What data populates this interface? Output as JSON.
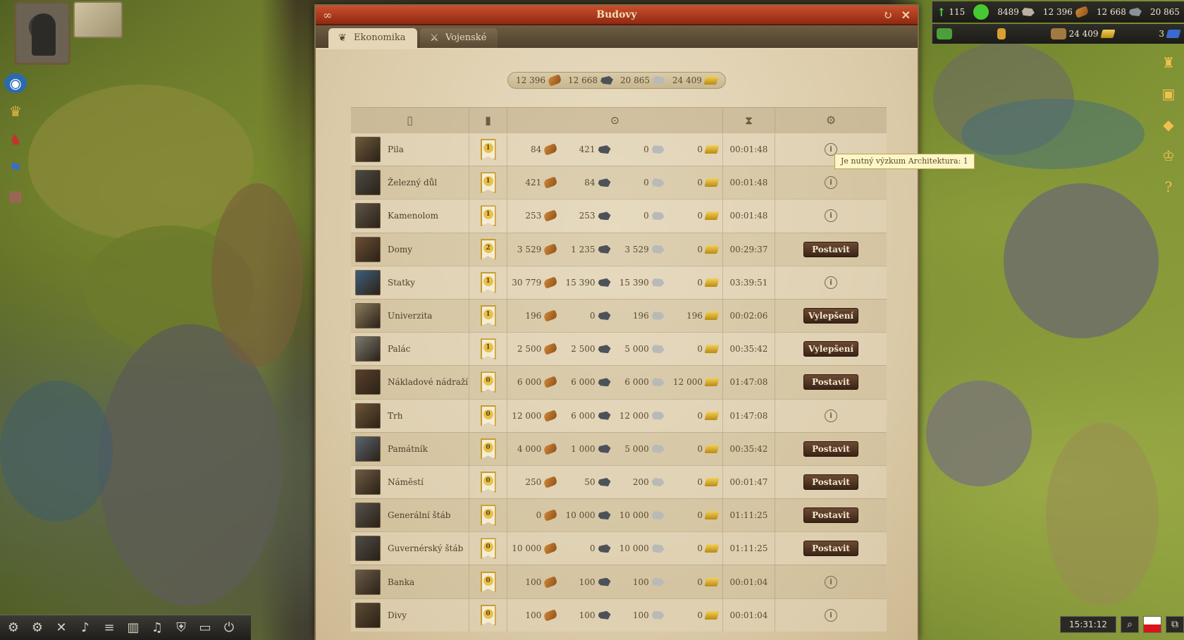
{
  "dialog": {
    "title": "Budovy",
    "tabs": [
      {
        "label": "Ekonomika",
        "active": true
      },
      {
        "label": "Vojenské",
        "active": false
      }
    ]
  },
  "summary": {
    "wood": "12 396",
    "iron": "12 668",
    "stone": "20 865",
    "gold": "24 409"
  },
  "buildings": [
    {
      "name": "Pila",
      "level": "1",
      "wood": "84",
      "iron": "421",
      "stone": "0",
      "gold": "0",
      "time": "00:01:48",
      "action": "info",
      "thumb": "#6f5a3c"
    },
    {
      "name": "Železný důl",
      "level": "1",
      "wood": "421",
      "iron": "84",
      "stone": "0",
      "gold": "0",
      "time": "00:01:48",
      "action": "info",
      "thumb": "#4c4a44"
    },
    {
      "name": "Kamenolom",
      "level": "1",
      "wood": "253",
      "iron": "253",
      "stone": "0",
      "gold": "0",
      "time": "00:01:48",
      "action": "info",
      "thumb": "#5e5446"
    },
    {
      "name": "Domy",
      "level": "2",
      "wood": "3 529",
      "iron": "1 235",
      "stone": "3 529",
      "gold": "0",
      "time": "00:29:37",
      "action": "button",
      "action_label": "Postavit",
      "thumb": "#6a4e34"
    },
    {
      "name": "Statky",
      "level": "1",
      "wood": "30 779",
      "iron": "15 390",
      "stone": "15 390",
      "gold": "0",
      "time": "03:39:51",
      "action": "info",
      "thumb": "#3f5e7a"
    },
    {
      "name": "Univerzita",
      "level": "1",
      "wood": "196",
      "iron": "0",
      "stone": "196",
      "gold": "196",
      "time": "00:02:06",
      "action": "button",
      "action_label": "Vylepšení",
      "thumb": "#8a7a5a"
    },
    {
      "name": "Palác",
      "level": "1",
      "wood": "2 500",
      "iron": "2 500",
      "stone": "5 000",
      "gold": "0",
      "time": "00:35:42",
      "action": "button",
      "action_label": "Vylepšení",
      "thumb": "#7a7a70"
    },
    {
      "name": "Nákladové nádraží",
      "level": "0",
      "wood": "6 000",
      "iron": "6 000",
      "stone": "6 000",
      "gold": "12 000",
      "time": "01:47:08",
      "action": "button",
      "action_label": "Postavit",
      "thumb": "#5a3f2a"
    },
    {
      "name": "Trh",
      "level": "0",
      "wood": "12 000",
      "iron": "6 000",
      "stone": "12 000",
      "gold": "0",
      "time": "01:47:08",
      "action": "info",
      "thumb": "#6e5436"
    },
    {
      "name": "Památník",
      "level": "0",
      "wood": "4 000",
      "iron": "1 000",
      "stone": "5 000",
      "gold": "0",
      "time": "00:35:42",
      "action": "button",
      "action_label": "Postavit",
      "thumb": "#5b6470"
    },
    {
      "name": "Náměstí",
      "level": "0",
      "wood": "250",
      "iron": "50",
      "stone": "200",
      "gold": "0",
      "time": "00:01:47",
      "action": "button",
      "action_label": "Postavit",
      "thumb": "#6f5a44"
    },
    {
      "name": "Generální štáb",
      "level": "0",
      "wood": "0",
      "iron": "10 000",
      "stone": "10 000",
      "gold": "0",
      "time": "01:11:25",
      "action": "button",
      "action_label": "Postavit",
      "thumb": "#55524c"
    },
    {
      "name": "Guvernérský štáb",
      "level": "0",
      "wood": "10 000",
      "iron": "0",
      "stone": "10 000",
      "gold": "0",
      "time": "01:11:25",
      "action": "button",
      "action_label": "Postavit",
      "thumb": "#4e4b48"
    },
    {
      "name": "Banka",
      "level": "0",
      "wood": "100",
      "iron": "100",
      "stone": "100",
      "gold": "0",
      "time": "00:01:04",
      "action": "info",
      "thumb": "#6b5c48"
    },
    {
      "name": "Divy",
      "level": "0",
      "wood": "100",
      "iron": "100",
      "stone": "100",
      "gold": "0",
      "time": "00:01:04",
      "action": "info",
      "thumb": "#5e4a34"
    }
  ],
  "tooltip": "Je nutný výzkum Architektura: 1",
  "top_resources": {
    "arrow_value": "115",
    "population": "8489",
    "wood": "12 396",
    "iron": "12 668",
    "stone": "20 865",
    "gold": "24 409",
    "other": "3"
  },
  "clock": "15:31:12",
  "colors": {
    "title_bar": "#b1401f",
    "panel": "#e4d6b6",
    "button": "#4e3222",
    "tooltip_bg": "#fdf6c6"
  }
}
